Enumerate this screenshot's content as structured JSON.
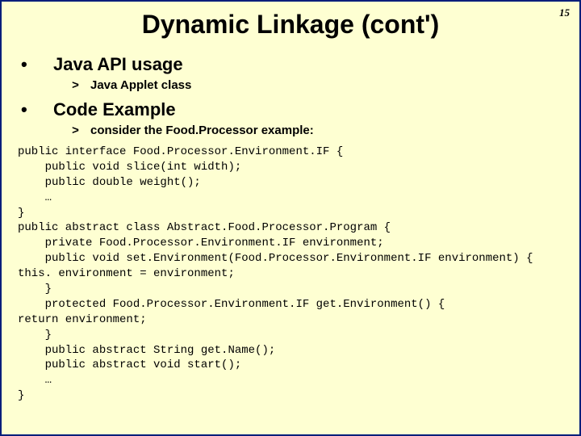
{
  "page_number": "15",
  "title": "Dynamic Linkage (cont')",
  "bullets": [
    {
      "text": "Java API usage",
      "sub": {
        "marker": ">",
        "text": "Java Applet class"
      }
    },
    {
      "text": "Code Example",
      "sub": {
        "marker": ">",
        "text": "consider the Food.Processor example:"
      }
    }
  ],
  "code": "public interface Food.Processor.Environment.IF {\n    public void slice(int width);\n    public double weight();\n    …\n}\npublic abstract class Abstract.Food.Processor.Program {\n    private Food.Processor.Environment.IF environment;\n    public void set.Environment(Food.Processor.Environment.IF environment) {\nthis. environment = environment;\n    }\n    protected Food.Processor.Environment.IF get.Environment() {\nreturn environment;\n    }\n    public abstract String get.Name();\n    public abstract void start();\n    …\n}"
}
